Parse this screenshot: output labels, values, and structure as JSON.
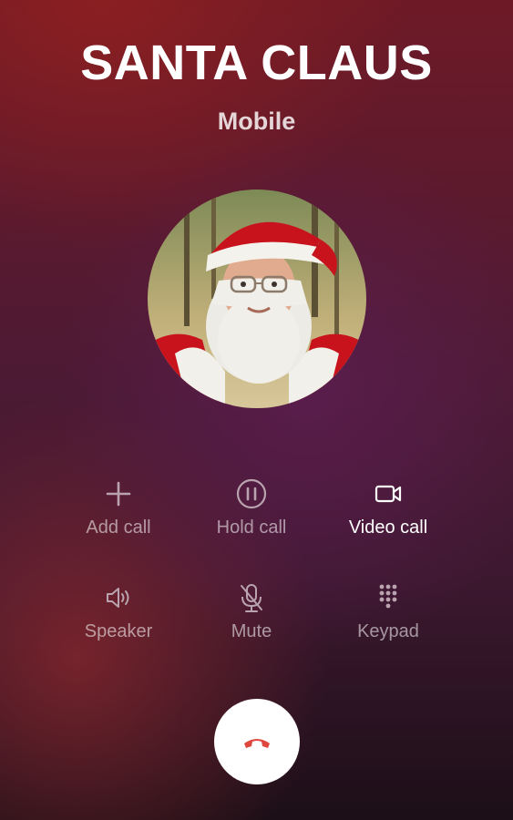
{
  "caller": {
    "name": "SANTA CLAUS",
    "label": "Mobile"
  },
  "controls": [
    {
      "label": "Add call",
      "icon": "plus-icon",
      "active": false
    },
    {
      "label": "Hold call",
      "icon": "pause-icon",
      "active": false
    },
    {
      "label": "Video call",
      "icon": "video-camera-icon",
      "active": true
    },
    {
      "label": "Speaker",
      "icon": "speaker-icon",
      "active": false
    },
    {
      "label": "Mute",
      "icon": "microphone-muted-icon",
      "active": false
    },
    {
      "label": "Keypad",
      "icon": "keypad-icon",
      "active": false
    }
  ],
  "end_call": {
    "icon": "phone-hangup-icon",
    "color": "#e0473e"
  },
  "colors": {
    "inactive": "#b9a3ae",
    "active": "#ffffff"
  }
}
